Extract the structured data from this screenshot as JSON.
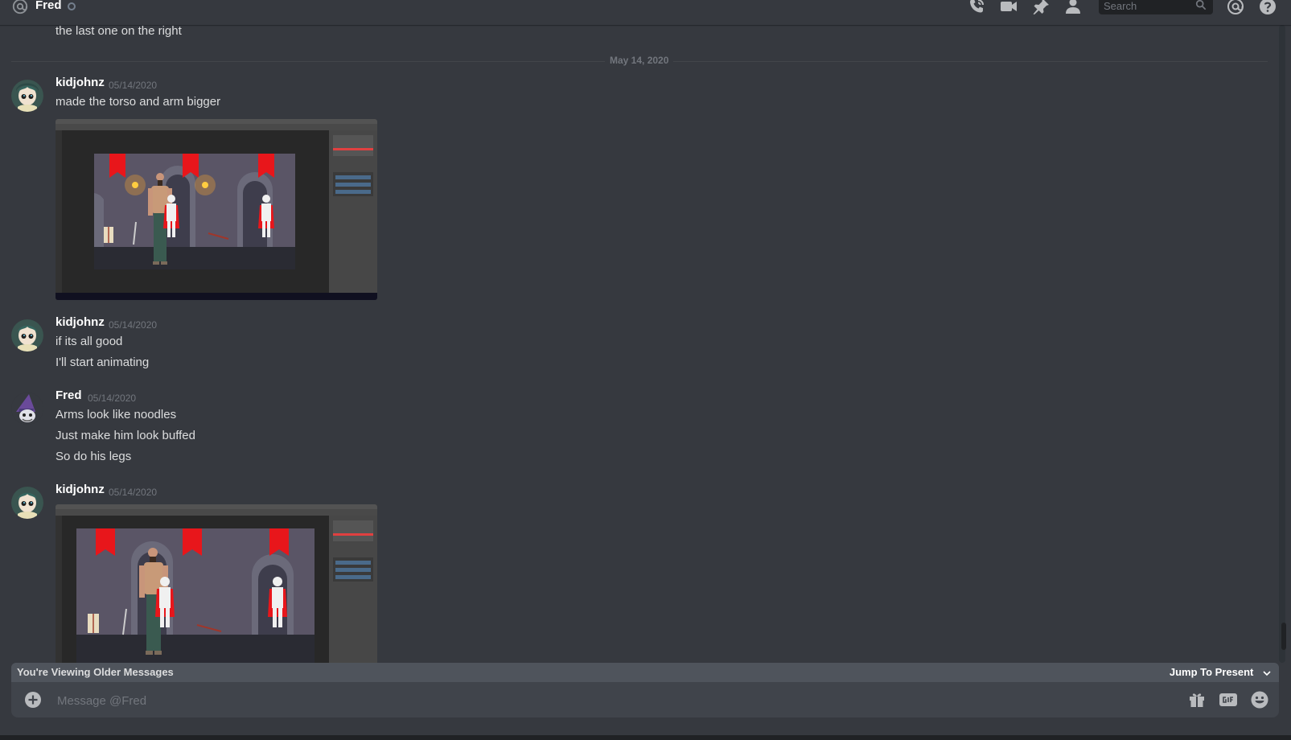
{
  "header": {
    "channel_name": "Fred",
    "search_placeholder": "Search",
    "icons": [
      "at-icon",
      "phone-call-icon",
      "video-call-icon",
      "pin-icon",
      "add-friend-icon",
      "search-icon",
      "mentions-icon",
      "help-icon"
    ]
  },
  "messages": {
    "first_line": "the last one on the right",
    "date_divider": "May 14, 2020",
    "groups": [
      {
        "username": "kidjohnz",
        "timestamp": "05/14/2020",
        "lines": [
          "made the torso and arm bigger"
        ],
        "has_attachment": true
      },
      {
        "username": "kidjohnz",
        "timestamp": "05/14/2020",
        "lines": [
          "if its all good",
          "I'll start animating"
        ]
      },
      {
        "username": "Fred",
        "timestamp": "05/14/2020",
        "lines": [
          "Arms look like noodles",
          "Just make him look buffed",
          "So do his legs"
        ]
      },
      {
        "username": "kidjohnz",
        "timestamp": "05/14/2020",
        "lines": [],
        "has_attachment": true
      }
    ]
  },
  "older_bar": {
    "text": "You're Viewing Older Messages",
    "jump_label": "Jump To Present"
  },
  "composer": {
    "placeholder": "Message @Fred",
    "icons": [
      "plus-icon",
      "gift-icon",
      "gif-icon",
      "emoji-icon"
    ]
  },
  "colors": {
    "background": "#36393f",
    "header_text": "#ffffff",
    "muted_text": "#72767d",
    "older_bar": "#4f545c",
    "composer": "#40444b",
    "banner_red": "#e8161b"
  }
}
